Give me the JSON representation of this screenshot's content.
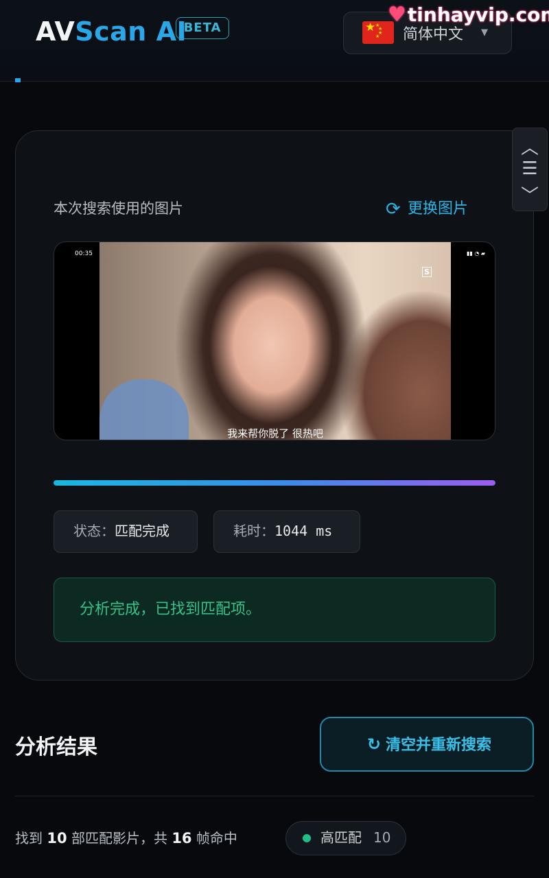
{
  "header": {
    "logo_part1": "AV",
    "logo_part2": "Scan AI",
    "beta_label": "BETA",
    "language": "简体中文",
    "watermark": "tinhayvip.com"
  },
  "scroll_controls": {
    "up": "^",
    "menu": "=",
    "down": "v"
  },
  "image_section": {
    "label": "本次搜索使用的图片",
    "change_label": "更换图片",
    "preview": {
      "status_time": "00:35",
      "subtitle": "我来帮你脱了 很热吧"
    }
  },
  "progress": {
    "value_percent": 100
  },
  "status": {
    "state_label": "状态：",
    "state_value": "匹配完成",
    "time_label": "耗时：",
    "time_value": "1044 ms"
  },
  "success_message": "分析完成，已找到匹配项。",
  "results": {
    "title": "分析结果",
    "reset_label": "清空并重新搜索",
    "found_prefix": "找到",
    "found_count": "10",
    "found_mid": "部匹配影片，共",
    "frame_count": "16",
    "found_suffix": "帧命中",
    "badge_label": "高匹配",
    "badge_count": "10"
  },
  "colors": {
    "accent": "#2aa7e8",
    "success": "#34c48a",
    "progress_start": "#1bb7e0",
    "progress_end": "#9b5cf0",
    "badge_dot": "#1fbf86"
  },
  "icons": {
    "refresh": "refresh-icon",
    "reload": "reload-icon",
    "caret": "chevron-down-icon",
    "flag": "china-flag-icon"
  }
}
